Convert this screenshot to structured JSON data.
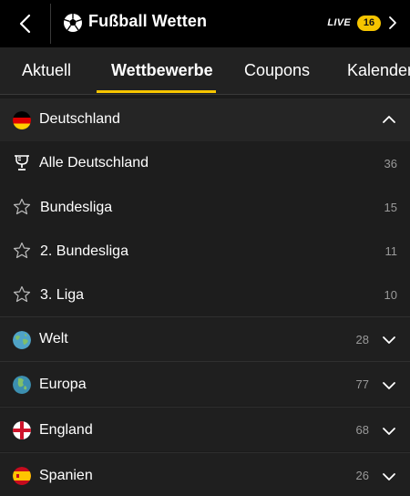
{
  "header": {
    "title": "Fußball Wetten",
    "live_label": "LIVE",
    "live_count": "16"
  },
  "tabs": [
    {
      "label": "Aktuell"
    },
    {
      "label": "Wettbewerbe"
    },
    {
      "label": "Coupons"
    },
    {
      "label": "Kalender"
    }
  ],
  "section": {
    "label": "Deutschland"
  },
  "leagues": [
    {
      "label": "Alle Deutschland",
      "count": "36",
      "icon": "trophy-icon"
    },
    {
      "label": "Bundesliga",
      "count": "15",
      "icon": "star-outline-icon"
    },
    {
      "label": "2. Bundesliga",
      "count": "11",
      "icon": "star-outline-icon"
    },
    {
      "label": "3. Liga",
      "count": "10",
      "icon": "star-outline-icon"
    }
  ],
  "categories": [
    {
      "label": "Welt",
      "count": "28",
      "icon": "globe-icon"
    },
    {
      "label": "Europa",
      "count": "77",
      "icon": "globe-europe-icon"
    },
    {
      "label": "England",
      "count": "68",
      "icon": "flag-england-icon"
    },
    {
      "label": "Spanien",
      "count": "26",
      "icon": "flag-spain-icon"
    }
  ],
  "colors": {
    "accent": "#f6c500",
    "header_bg": "#000000",
    "tabs_bg": "#222222",
    "count_text": "#9a9a9a"
  }
}
